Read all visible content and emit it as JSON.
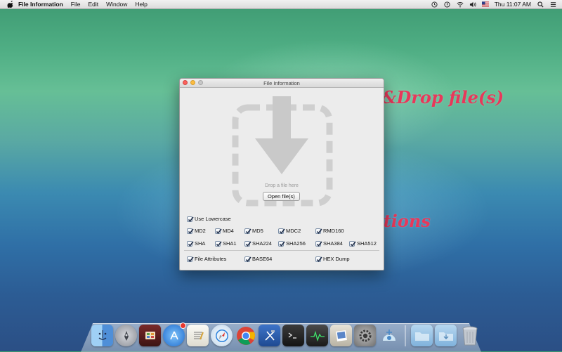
{
  "menubar": {
    "app_name": "File Information",
    "menus": [
      "File",
      "Edit",
      "Window",
      "Help"
    ],
    "clock": "Thu 11:07 AM",
    "status_icons": [
      "time-machine-icon",
      "alert-icon",
      "wifi-icon",
      "volume-icon",
      "flag-icon",
      "search-icon",
      "list-icon"
    ]
  },
  "window": {
    "title": "File Information",
    "drop_text": "Drop a file here",
    "open_button": "Open file(s)",
    "options": {
      "use_lowercase": {
        "label": "Use Lowercase",
        "checked": true
      },
      "hashes_row1": [
        {
          "label": "MD2",
          "checked": true
        },
        {
          "label": "MD4",
          "checked": true
        },
        {
          "label": "MD5",
          "checked": true
        },
        {
          "label": "MDC2",
          "checked": true
        },
        {
          "label": "RMD160",
          "checked": true
        }
      ],
      "hashes_row2": [
        {
          "label": "SHA",
          "checked": true
        },
        {
          "label": "SHA1",
          "checked": true
        },
        {
          "label": "SHA224",
          "checked": true
        },
        {
          "label": "SHA256",
          "checked": true
        },
        {
          "label": "SHA384",
          "checked": true
        },
        {
          "label": "SHA512",
          "checked": true
        }
      ],
      "extras": [
        {
          "label": "File Attributes",
          "checked": true
        },
        {
          "label": "BASE64",
          "checked": true
        },
        {
          "label": "HEX Dump",
          "checked": true
        }
      ]
    }
  },
  "annotations": {
    "drag_drop": "Drag&Drop file(s)",
    "options": "Options"
  },
  "dock": {
    "apps": [
      "finder-icon",
      "launchpad-icon",
      "photo-booth-icon",
      "app-store-icon",
      "textedit-icon",
      "safari-icon",
      "chrome-icon",
      "xcode-icon",
      "terminal-icon",
      "activity-monitor-icon",
      "iphoto-icon",
      "system-preferences-icon",
      "network-utility-icon"
    ],
    "stacks": [
      "applications-folder-icon",
      "downloads-folder-icon",
      "trash-icon"
    ]
  },
  "colors": {
    "annotation": "#e8385a",
    "accent": "#3f7dd6"
  }
}
